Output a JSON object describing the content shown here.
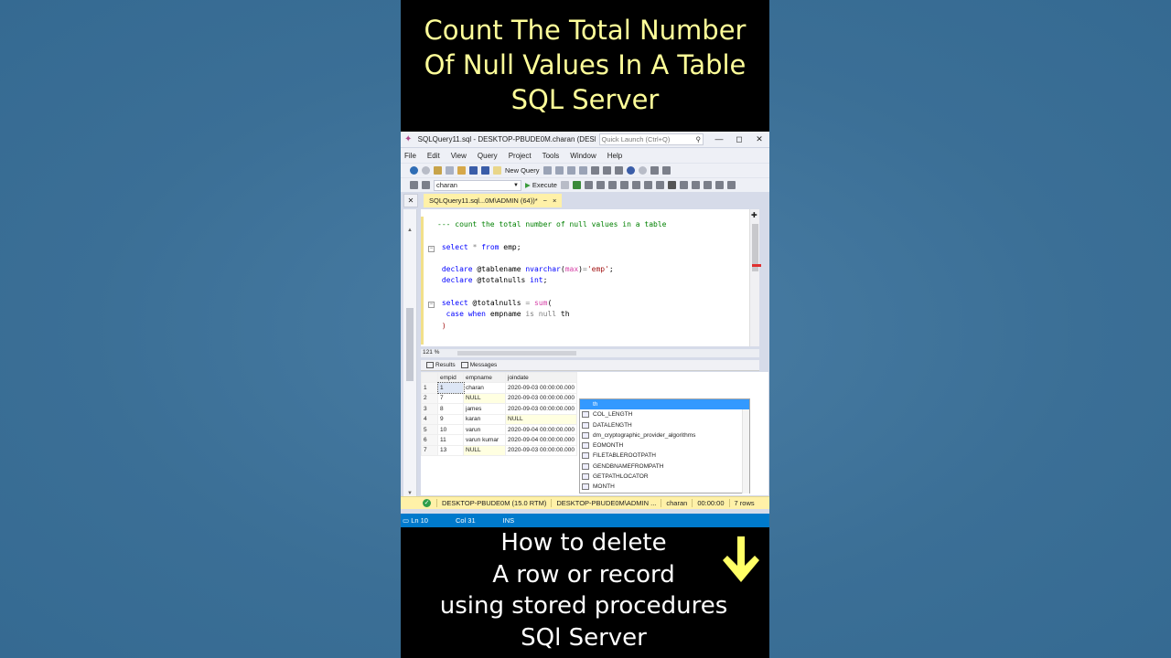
{
  "top_caption": [
    "Count The Total Number",
    "Of Null Values In A Table",
    "SQL Server"
  ],
  "bottom_caption": [
    "How to delete",
    "A row or record",
    "using stored procedures",
    "SQl Server"
  ],
  "window": {
    "title": "SQLQuery11.sql - DESKTOP-PBUDE0M.charan (DESK...",
    "quick_launch_placeholder": "Quick Launch (Ctrl+Q)"
  },
  "menu": [
    "File",
    "Edit",
    "View",
    "Query",
    "Project",
    "Tools",
    "Window",
    "Help"
  ],
  "toolbar": {
    "new_query": "New Query",
    "database": "charan",
    "execute": "Execute"
  },
  "doc_tab": {
    "label": "SQLQuery11.sql...0M\\ADMIN (64))*",
    "pin": "−",
    "close": "×"
  },
  "editor": {
    "zoom": "121 %"
  },
  "results": {
    "tabs": [
      "Results",
      "Messages"
    ],
    "columns": [
      "empid",
      "empname",
      "joindate"
    ],
    "rows": [
      {
        "n": "1",
        "empid": "1",
        "empname": "charan",
        "joindate": "2020-09-03 00:00:00.000"
      },
      {
        "n": "2",
        "empid": "7",
        "empname": "NULL",
        "joindate": "2020-09-03 00:00:00.000"
      },
      {
        "n": "3",
        "empid": "8",
        "empname": "james",
        "joindate": "2020-09-03 00:00:00.000"
      },
      {
        "n": "4",
        "empid": "9",
        "empname": "karan",
        "joindate": "NULL"
      },
      {
        "n": "5",
        "empid": "10",
        "empname": "varun",
        "joindate": "2020-09-04 00:00:00.000"
      },
      {
        "n": "6",
        "empid": "11",
        "empname": "varun kumar",
        "joindate": "2020-09-04 00:00:00.000"
      },
      {
        "n": "7",
        "empid": "13",
        "empname": "NULL",
        "joindate": "2020-09-03 00:00:00.000"
      }
    ]
  },
  "autocomplete": {
    "typed": "th",
    "items": [
      "COL_LENGTH",
      "DATALENGTH",
      "dm_cryptographic_provider_algorithms",
      "EOMONTH",
      "FILETABLEROOTPATH",
      "GENDBNAMEFROMPATH",
      "GETPATHLOCATOR",
      "MONTH"
    ]
  },
  "status": {
    "server": "DESKTOP-PBUDE0M (15.0 RTM)",
    "user": "DESKTOP-PBUDE0M\\ADMIN ...",
    "db": "charan",
    "time": "00:00:00",
    "rows": "7 rows"
  },
  "bottom_status": {
    "ln": "Ln 10",
    "col": "Col 31",
    "mode": "INS"
  },
  "colors": {
    "caption_top": "#ffff99",
    "arrow": "#ffff66",
    "accent_blue": "#007acc",
    "status_yellow": "#fff1a8"
  }
}
